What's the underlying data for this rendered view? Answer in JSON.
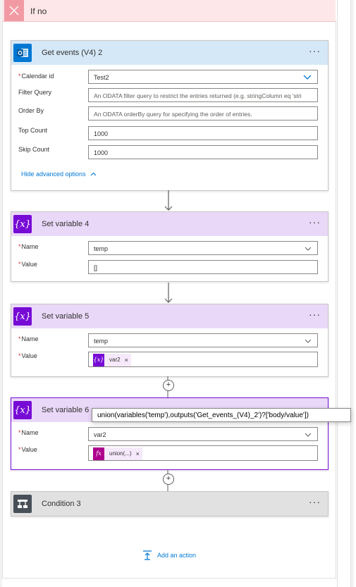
{
  "branch": {
    "title": "If no"
  },
  "cards": {
    "get_events": {
      "title": "Get events (V4) 2",
      "more": "···",
      "fields": {
        "calendar_id": {
          "label": "Calendar id",
          "value": "Test2"
        },
        "filter_query": {
          "label": "Filter Query",
          "placeholder": "An ODATA filter query to restrict the entries returned (e.g. stringColumn eq 'stri"
        },
        "order_by": {
          "label": "Order By",
          "placeholder": "An ODATA orderBy query for specifying the order of entries."
        },
        "top_count": {
          "label": "Top Count",
          "value": "1000"
        },
        "skip_count": {
          "label": "Skip Count",
          "value": "1000"
        }
      },
      "advanced_link": "Hide advanced options"
    },
    "set_var_4": {
      "title": "Set variable 4",
      "more": "···",
      "name_label": "Name",
      "name_value": "temp",
      "value_label": "Value",
      "value_value": "[]"
    },
    "set_var_5": {
      "title": "Set variable 5",
      "more": "···",
      "name_label": "Name",
      "name_value": "temp",
      "value_label": "Value",
      "token_label": "var2",
      "token_icon": "{x}",
      "token_remove": "×"
    },
    "set_var_6": {
      "title": "Set variable 6",
      "more": "···",
      "name_label": "Name",
      "name_value": "var2",
      "value_label": "Value",
      "token_label": "union(...)",
      "token_icon": "fx",
      "token_remove": "×"
    },
    "condition": {
      "title": "Condition 3",
      "more": "···"
    }
  },
  "tooltip": {
    "text": "union(variables('temp'),outputs('Get_events_(V4)_2')?['body/value'])"
  },
  "add_action": {
    "label": "Add an action"
  },
  "plus_symbol": "+",
  "required_mark": "*",
  "variable_icon_text": "{x}",
  "colors": {
    "variable_purple": "#770bd6",
    "variable_header_bg": "#ead8f8",
    "outlook_blue": "#0078d4",
    "outlook_header_bg": "#d5e8f8",
    "condition_dark": "#484f58",
    "condition_header_bg": "#e1e1e1",
    "fx_magenta": "#ad008c",
    "branch_red_bg": "#fde7e9",
    "link_blue": "#0078d4"
  }
}
